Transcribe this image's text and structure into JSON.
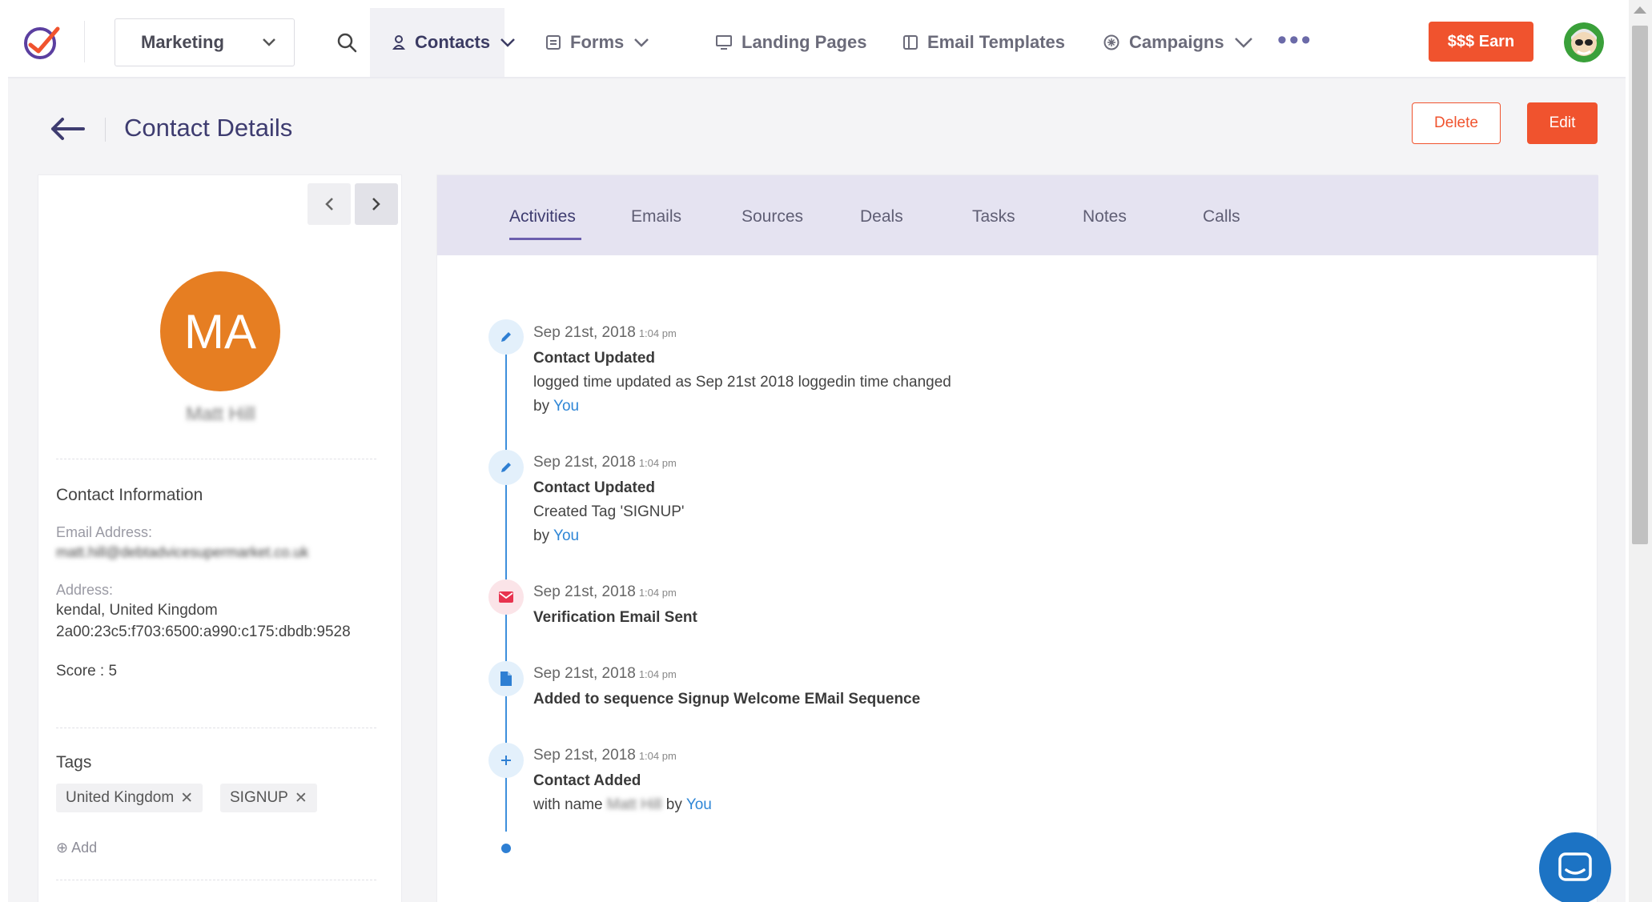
{
  "nav": {
    "workspace_label": "Marketing",
    "items": [
      {
        "label": "Contacts"
      },
      {
        "label": "Forms"
      },
      {
        "label": "Landing Pages"
      },
      {
        "label": "Email Templates"
      },
      {
        "label": "Campaigns"
      }
    ],
    "more": "•••",
    "earn_label": "$$$ Earn"
  },
  "header": {
    "title": "Contact Details",
    "delete_label": "Delete",
    "edit_label": "Edit"
  },
  "contact": {
    "initials": "MA",
    "name": "Matt Hill",
    "info_title": "Contact Information",
    "email_label": "Email Address:",
    "email": "matt.hill@debtadvicesupermarket.co.uk",
    "address_label": "Address:",
    "address_line1": "kendal, United Kingdom",
    "address_line2": "2a00:23c5:f703:6500:a990:c175:dbdb:9528",
    "score": "Score : 5",
    "tags_title": "Tags",
    "tags": [
      {
        "label": "United Kingdom",
        "remove": "✕"
      },
      {
        "label": "SIGNUP",
        "remove": "✕"
      }
    ],
    "add_tag_icon": "⊕",
    "add_tag_label": "Add"
  },
  "tabs": [
    {
      "label": "Activities"
    },
    {
      "label": "Emails"
    },
    {
      "label": "Sources"
    },
    {
      "label": "Deals"
    },
    {
      "label": "Tasks"
    },
    {
      "label": "Notes"
    },
    {
      "label": "Calls"
    }
  ],
  "activities": [
    {
      "icon": "pencil-icon",
      "date": "Sep 21st, 2018",
      "time": "1:04 pm",
      "title": "Contact Updated",
      "desc": "logged time updated as Sep 21st 2018 loggedin time changed",
      "by": "by",
      "by_user": "You"
    },
    {
      "icon": "pencil-icon",
      "date": "Sep 21st, 2018",
      "time": "1:04 pm",
      "title": "Contact Updated",
      "desc": "Created Tag 'SIGNUP'",
      "by": "by",
      "by_user": "You"
    },
    {
      "icon": "envelope-icon",
      "date": "Sep 21st, 2018",
      "time": "1:04 pm",
      "title": "Verification Email Sent"
    },
    {
      "icon": "document-icon",
      "date": "Sep 21st, 2018",
      "time": "1:04 pm",
      "title": "Added to sequence Signup Welcome EMail Sequence"
    },
    {
      "icon": "plus-icon",
      "date": "Sep 21st, 2018",
      "time": "1:04 pm",
      "title": "Contact Added",
      "desc_prefix": "with name",
      "desc_name": "Matt Hill",
      "by": "by",
      "by_user": "You"
    }
  ],
  "colors": {
    "accent": "#f0532e",
    "brand_purple": "#3e3c70",
    "tab_bar": "#e5e3f1",
    "timeline": "#3d8fdc",
    "avatar_orange": "#e67e22"
  }
}
